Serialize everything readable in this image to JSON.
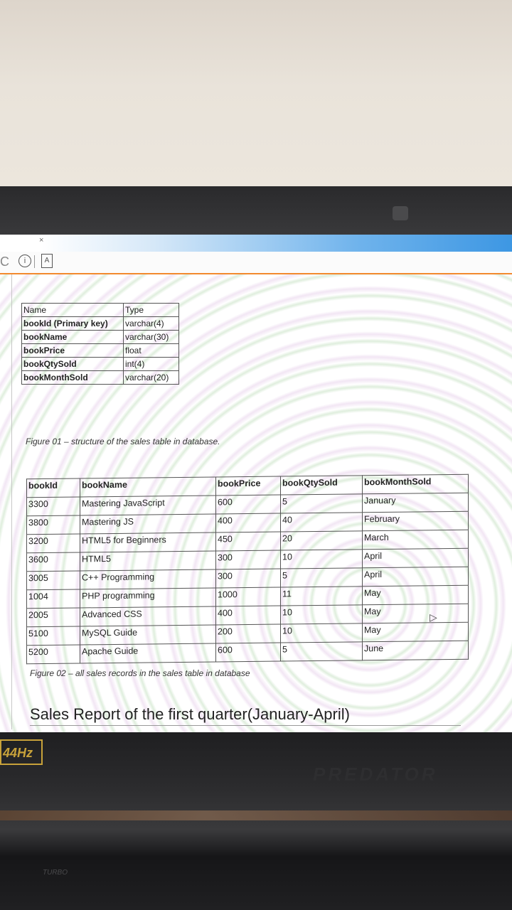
{
  "fig1": {
    "col_headers": [
      "Name",
      "Type"
    ],
    "rows": [
      {
        "name": "bookId     (Primary key)",
        "type": "varchar(4)"
      },
      {
        "name": "bookName",
        "type": "varchar(30)"
      },
      {
        "name": "bookPrice",
        "type": "float"
      },
      {
        "name": "bookQtySold",
        "type": "int(4)"
      },
      {
        "name": "bookMonthSold",
        "type": "varchar(20)"
      }
    ],
    "caption": "Figure 01 – structure of the sales table in database."
  },
  "fig2": {
    "col_headers": [
      "bookId",
      "bookName",
      "bookPrice",
      "bookQtySold",
      "bookMonthSold"
    ],
    "rows": [
      [
        "3300",
        "Mastering JavaScript",
        "600",
        "5",
        "January"
      ],
      [
        "3800",
        "Mastering JS",
        "400",
        "40",
        "February"
      ],
      [
        "3200",
        "HTML5 for Beginners",
        "450",
        "20",
        "March"
      ],
      [
        "3600",
        "HTML5",
        "300",
        "10",
        "April"
      ],
      [
        "3005",
        "C++ Programming",
        "300",
        "5",
        "April"
      ],
      [
        "1004",
        "PHP programming",
        "1000",
        "11",
        "May"
      ],
      [
        "2005",
        "Advanced CSS",
        "400",
        "10",
        "May"
      ],
      [
        "5100",
        "MySQL Guide",
        "200",
        "10",
        "May"
      ],
      [
        "5200",
        "Apache Guide",
        "600",
        "5",
        "June"
      ]
    ],
    "caption": "Figure 02 – all sales records in the sales table in database"
  },
  "heading": "Sales Report of the first quarter(January-April)",
  "browser": {
    "tab_close": "×",
    "reload": "C",
    "info": "i",
    "doc": "A"
  },
  "monitor": {
    "refresh_badge": "44Hz",
    "brand": "PREDATOR",
    "turbo": "TURBO"
  }
}
